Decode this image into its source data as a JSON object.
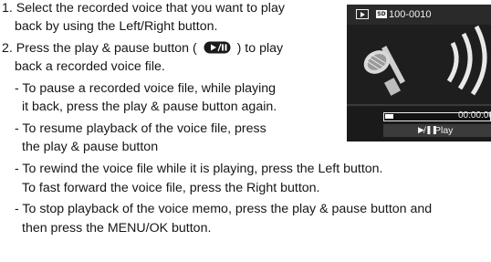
{
  "instructions": {
    "line_1": "1. Select the recorded voice that you want to play",
    "line_2": "back by using the Left/Right button.",
    "line_3_before_icon": "2. Press the play & pause button (",
    "line_3_after_icon": ") to play",
    "line_4": "back a recorded voice file.",
    "line_5": "- To pause a recorded voice file, while playing",
    "line_6": "it back, press the play & pause button again.",
    "line_7": "- To resume playback of the voice file, press",
    "line_8": "the play & pause button",
    "line_9": "- To rewind the voice file while it is playing, press the Left button.",
    "line_10": "To fast forward the voice file, press the Right button.",
    "line_11": "- To stop playback of the voice memo, press the play & pause button and",
    "line_12": "then press the MENU/OK button."
  },
  "icons": {
    "play_pause_button": "play-pause-button-icon",
    "mode": "playback-mode-icon",
    "memory_card": "memory-card-icon",
    "microphone": "microphone-icon",
    "sound_waves": "sound-waves-icon"
  },
  "screen": {
    "file_number": "100-0010",
    "time": "00:00:00",
    "play_glyph": "▶/❚❚",
    "play_label": "Play",
    "progress": 0.08
  },
  "colors": {
    "text": "#161616",
    "screen_background": "#1a1a1a",
    "screen_bar": "#3b3b3b",
    "screen_text": "#f2f2f2"
  }
}
